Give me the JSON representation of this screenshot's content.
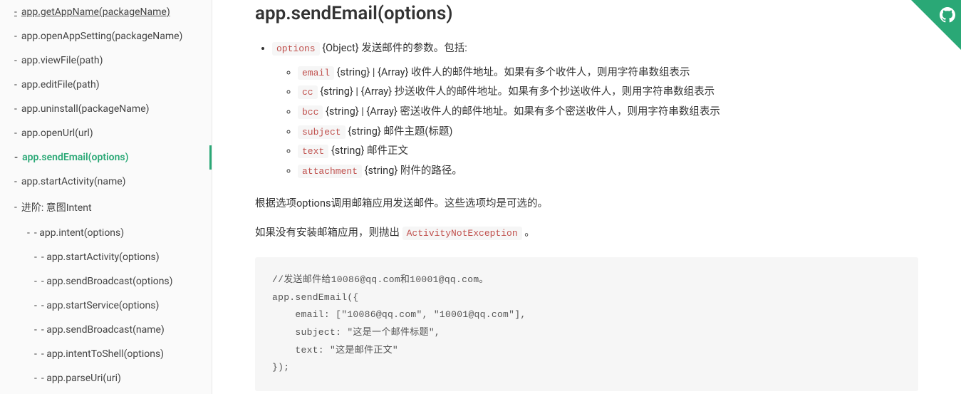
{
  "sidebar": {
    "items": [
      {
        "label": "app.getAppName(packageName)",
        "level": 1
      },
      {
        "label": "app.openAppSetting(packageName)",
        "level": 1
      },
      {
        "label": "app.viewFile(path)",
        "level": 1
      },
      {
        "label": "app.editFile(path)",
        "level": 1
      },
      {
        "label": "app.uninstall(packageName)",
        "level": 1
      },
      {
        "label": "app.openUrl(url)",
        "level": 1
      },
      {
        "label": "app.sendEmail(options)",
        "level": 1,
        "active": true
      },
      {
        "label": "app.startActivity(name)",
        "level": 1
      },
      {
        "label": "进阶: 意图Intent",
        "level": 1
      },
      {
        "label": "- app.intent(options)",
        "level": 2
      },
      {
        "label": "- app.startActivity(options)",
        "level": 3
      },
      {
        "label": "- app.sendBroadcast(options)",
        "level": 3
      },
      {
        "label": "- app.startService(options)",
        "level": 3
      },
      {
        "label": "- app.sendBroadcast(name)",
        "level": 3
      },
      {
        "label": "- app.intentToShell(options)",
        "level": 3
      },
      {
        "label": "- app.parseUri(uri)",
        "level": 3
      }
    ]
  },
  "main": {
    "title": "app.sendEmail(options)",
    "options_code": "options",
    "options_text": " {Object} 发送邮件的参数。包括:",
    "params": [
      {
        "code": "email",
        "text": " {string} | {Array} 收件人的邮件地址。如果有多个收件人，则用字符串数组表示"
      },
      {
        "code": "cc",
        "text": " {string} | {Array} 抄送收件人的邮件地址。如果有多个抄送收件人，则用字符串数组表示"
      },
      {
        "code": "bcc",
        "text": " {string} | {Array} 密送收件人的邮件地址。如果有多个密送收件人，则用字符串数组表示"
      },
      {
        "code": "subject",
        "text": " {string} 邮件主题(标题)"
      },
      {
        "code": "text",
        "text": " {string} 邮件正文"
      },
      {
        "code": "attachment",
        "text": " {string} 附件的路径。"
      }
    ],
    "para1": "根据选项options调用邮箱应用发送邮件。这些选项均是可选的。",
    "para2_prefix": "如果没有安装邮箱应用，则抛出 ",
    "para2_code": "ActivityNotException",
    "para2_suffix": " 。",
    "code_block": "//发送邮件给10086@qq.com和10001@qq.com。\napp.sendEmail({\n    email: [\"10086@qq.com\", \"10001@qq.com\"],\n    subject: \"这是一个邮件标题\",\n    text: \"这是邮件正文\"\n});"
  }
}
